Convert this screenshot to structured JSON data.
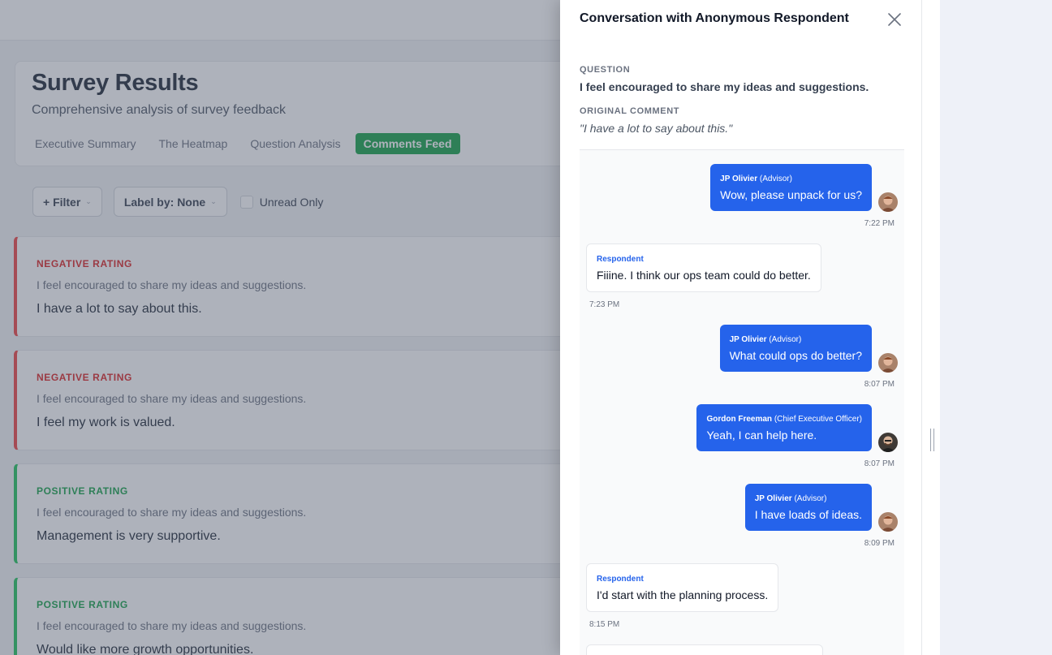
{
  "app": {
    "title": "Survey Results",
    "subtitle": "Comprehensive analysis of survey feedback",
    "tabs": [
      {
        "label": "Executive Summary",
        "active": false
      },
      {
        "label": "The Heatmap",
        "active": false
      },
      {
        "label": "Question Analysis",
        "active": false
      },
      {
        "label": "Comments Feed",
        "active": true
      }
    ],
    "filters": {
      "filter_label": "+ Filter",
      "label_by": "Label by: None",
      "unread_only": "Unread Only"
    },
    "comments": [
      {
        "rating": "NEGATIVE RATING",
        "sentiment": "negative",
        "question": "I feel encouraged to share my ideas and suggestions.",
        "text": "I have a lot to say about this."
      },
      {
        "rating": "NEGATIVE RATING",
        "sentiment": "negative",
        "question": "I feel encouraged to share my ideas and suggestions.",
        "text": "I feel my work is valued."
      },
      {
        "rating": "POSITIVE RATING",
        "sentiment": "positive",
        "question": "I feel encouraged to share my ideas and suggestions.",
        "text": "Management is very supportive."
      },
      {
        "rating": "POSITIVE RATING",
        "sentiment": "positive",
        "question": "I feel encouraged to share my ideas and suggestions.",
        "text": "Would like more growth opportunities."
      }
    ]
  },
  "drawer": {
    "title": "Conversation with Anonymous Respondent",
    "question_label": "QUESTION",
    "question": "I feel encouraged to share my ideas and suggestions.",
    "comment_label": "ORIGINAL COMMENT",
    "comment": "\"I have a lot to say about this.\"",
    "messages": [
      {
        "author": "JP Olivier",
        "role": "(Advisor)",
        "text": "Wow, please unpack for us?",
        "time": "7:22 PM",
        "side": "right"
      },
      {
        "author": "Respondent",
        "role": "",
        "text": "Fiiine. I think our ops team could do better.",
        "time": "7:23 PM",
        "side": "left"
      },
      {
        "author": "JP Olivier",
        "role": "(Advisor)",
        "text": "What could ops do better?",
        "time": "8:07 PM",
        "side": "right"
      },
      {
        "author": "Gordon Freeman",
        "role": "(Chief Executive Officer)",
        "text": "Yeah, I can help here.",
        "time": "8:07 PM",
        "side": "right"
      },
      {
        "author": "JP Olivier",
        "role": "(Advisor)",
        "text": "I have loads of ideas.",
        "time": "8:09 PM",
        "side": "right"
      },
      {
        "author": "Respondent",
        "role": "",
        "text": "I'd start with the planning process.",
        "time": "8:15 PM",
        "side": "left"
      }
    ]
  },
  "colors": {
    "accent": "#2563eb",
    "active_tab": "#16a34a",
    "negative": "#ef4444",
    "positive": "#22c55e"
  }
}
